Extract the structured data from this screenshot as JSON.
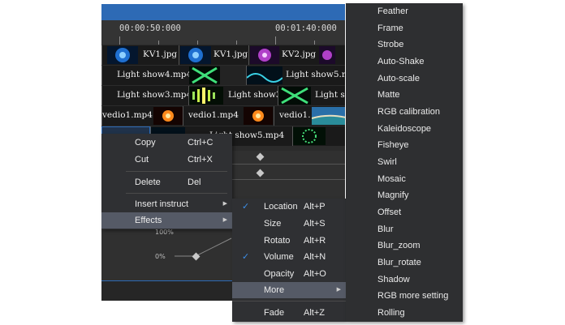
{
  "timeline": {
    "timecodes": [
      "00:00:50:000",
      "00:01:40:000"
    ],
    "tracks": [
      {
        "clips": [
          {
            "label": "",
            "thumb": "blue-particles"
          },
          {
            "label": "KV1.jpg",
            "thumb": "blue-particles"
          },
          {
            "label": "KV1.jpg",
            "thumb": "purple-flare"
          },
          {
            "label": "KV2.jpg",
            "thumb": "purple-flare"
          }
        ]
      },
      {
        "clips": [
          {
            "label": "Light show4.mp4",
            "thumb": "green-x"
          },
          {
            "label": "",
            "thumb": "cyan-waves"
          },
          {
            "label": "Light show5.mp",
            "thumb": "cyan-waves"
          }
        ]
      },
      {
        "clips": [
          {
            "label": "Light show3.mp4",
            "thumb": "green-bars"
          },
          {
            "label": "Light show3",
            "thumb": "green-burst"
          },
          {
            "label": "Light s",
            "thumb": "green-x"
          }
        ]
      },
      {
        "clips": [
          {
            "label": "vedio1.mp4",
            "thumb": "fire-orb"
          },
          {
            "label": "vedio1.mp4",
            "thumb": "fire-orb"
          },
          {
            "label": "vedio1.",
            "thumb": "ocean"
          }
        ]
      },
      {
        "clips": [
          {
            "label": "Light show5.mp4",
            "thumb": "cyan-waves"
          },
          {
            "label": "",
            "thumb": "green-burst"
          }
        ]
      }
    ],
    "keyframe_labels": {
      "top": "100%",
      "bottom": "0%"
    }
  },
  "context_menu": {
    "items": [
      {
        "label": "Copy",
        "shortcut": "Ctrl+C"
      },
      {
        "label": "Cut",
        "shortcut": "Ctrl+X"
      },
      {
        "label": "Delete",
        "shortcut": "Del"
      },
      {
        "label": "Insert instruct",
        "shortcut": ""
      },
      {
        "label": "Effects",
        "shortcut": ""
      }
    ]
  },
  "effects_menu": {
    "items": [
      {
        "label": "Location",
        "shortcut": "Alt+P",
        "checked": true
      },
      {
        "label": "Size",
        "shortcut": "Alt+S",
        "checked": false
      },
      {
        "label": "Rotato",
        "shortcut": "Alt+R",
        "checked": false
      },
      {
        "label": "Volume",
        "shortcut": "Alt+N",
        "checked": true
      },
      {
        "label": "Opacity",
        "shortcut": "Alt+O",
        "checked": false
      },
      {
        "label": "More",
        "shortcut": "",
        "checked": false
      },
      {
        "label": "Fade",
        "shortcut": "Alt+Z",
        "checked": false
      }
    ]
  },
  "more_menu": {
    "items": [
      "Feather",
      "Frame",
      "Strobe",
      "Auto-Shake",
      "Auto-scale",
      "Matte",
      "RGB calibration",
      "Kaleidoscope",
      "Fisheye",
      "Swirl",
      "Mosaic",
      "Magnify",
      "Offset",
      "Blur",
      "Blur_zoom",
      "Blur_rotate",
      "Shadow",
      "RGB more setting",
      "Rolling"
    ]
  },
  "colors": {
    "accent": "#2d6ab5",
    "check": "#3d8ee8",
    "menu_bg": "#2f3033",
    "menu_highlight": "#555a66"
  }
}
